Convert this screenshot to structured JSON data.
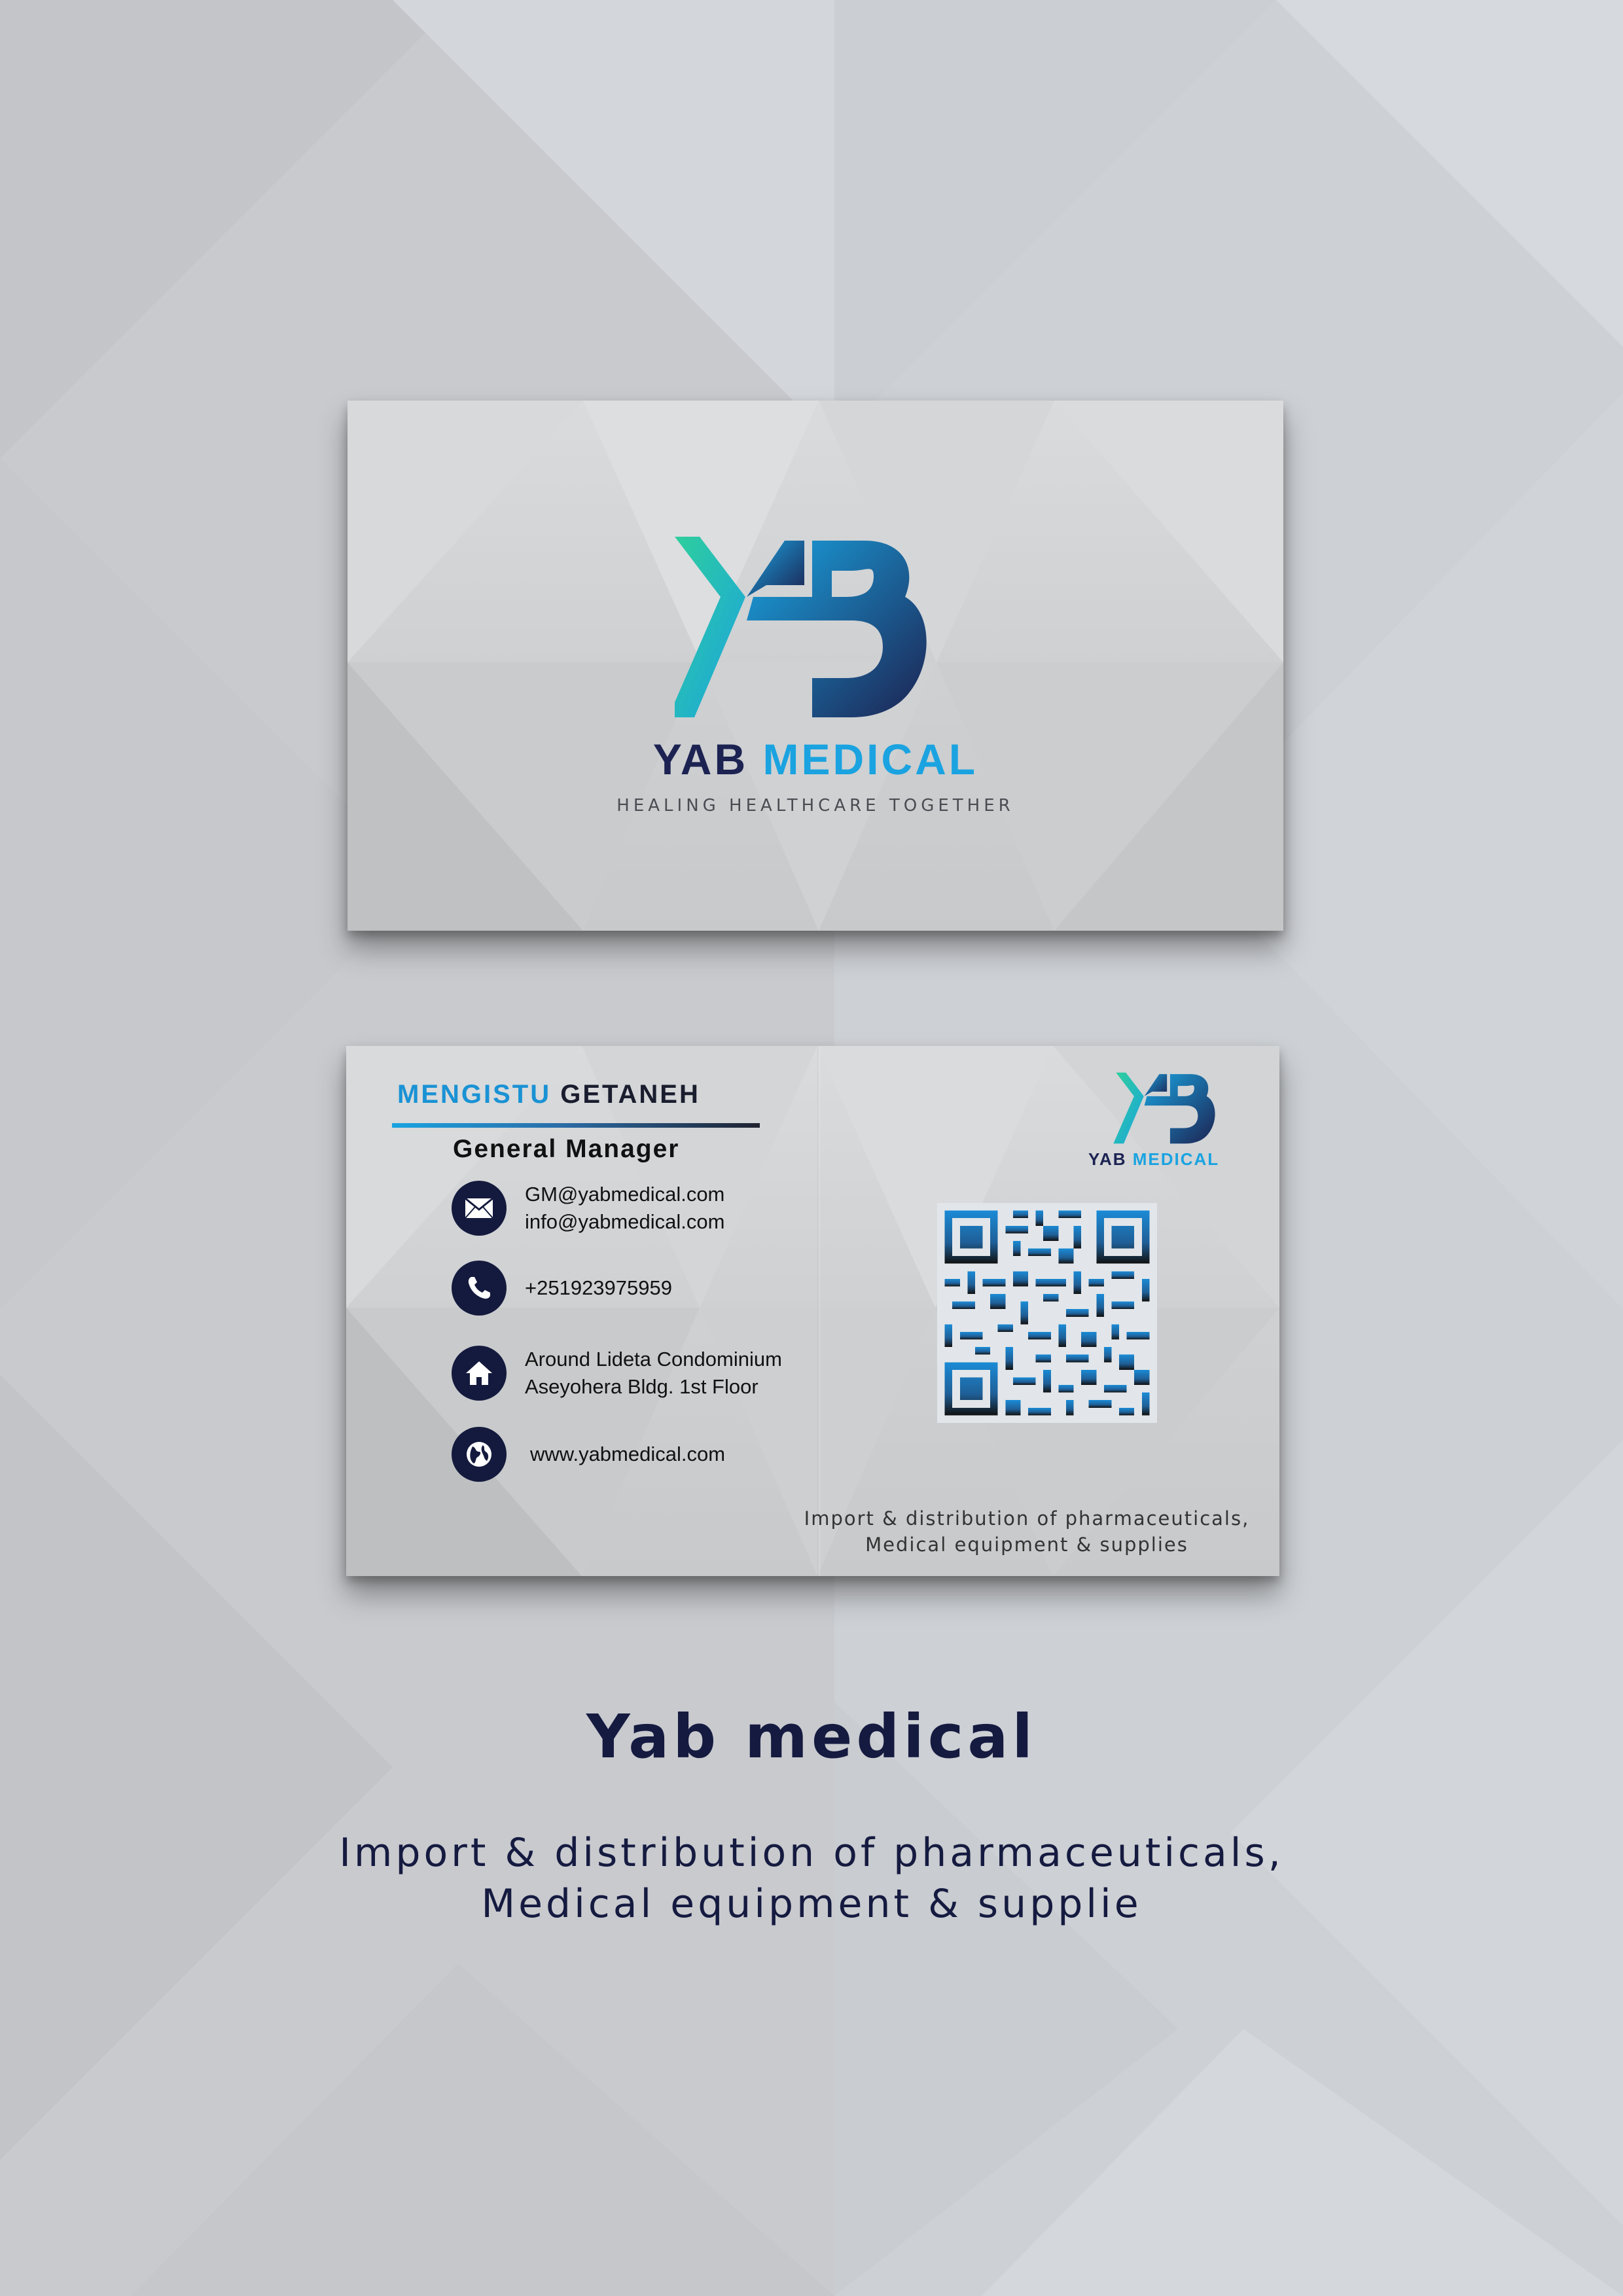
{
  "front": {
    "brand_part1": "YAB",
    "brand_part2": "MEDICAL",
    "tagline": "HEALING HEALTHCARE TOGETHER",
    "logo": "yb-monogram-logo"
  },
  "back": {
    "first_name": "MENGISTU",
    "last_name": "GETANEH",
    "role": "General Manager",
    "contacts": {
      "email_1": "GM@yabmedical.com",
      "email_2": "info@yabmedical.com",
      "phone": "+251923975959",
      "address_1": "Around Lideta Condominium",
      "address_2": "Aseyohera Bldg. 1st Floor",
      "website": "www.yabmedical.com"
    },
    "icons": [
      "envelope-icon",
      "phone-icon",
      "home-icon",
      "globe-icon"
    ],
    "mini_brand_part1": "YAB",
    "mini_brand_part2": "MEDICAL",
    "services_line_1": "Import & distribution of pharmaceuticals,",
    "services_line_2": "Medical equipment & supplies"
  },
  "caption": {
    "title": "Yab medical",
    "line_1": "Import & distribution of pharmaceuticals,",
    "line_2": "Medical equipment & supplie"
  },
  "colors": {
    "navy": "#1c2352",
    "cyan": "#1aa3e0",
    "teal": "#26c29a",
    "background": "#cfd2d6"
  }
}
